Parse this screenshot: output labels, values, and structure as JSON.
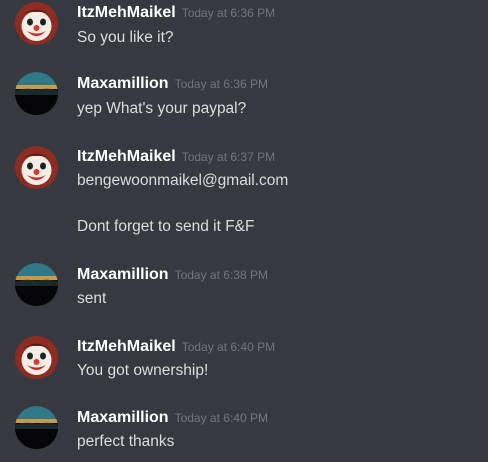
{
  "messages": [
    {
      "author": "ItzMehMaikel",
      "timestamp": "Today at 6:36 PM",
      "avatar": "clown-avatar-icon",
      "lines": [
        "So you like it?"
      ]
    },
    {
      "author": "Maxamillion",
      "timestamp": "Today at 6:36 PM",
      "avatar": "sunset-landscape-avatar-icon",
      "lines": [
        "yep What's your paypal?"
      ]
    },
    {
      "author": "ItzMehMaikel",
      "timestamp": "Today at 6:37 PM",
      "avatar": "clown-avatar-icon",
      "lines": [
        "bengewoonmaikel@gmail.com",
        "Dont forget to send it F&F"
      ]
    },
    {
      "author": "Maxamillion",
      "timestamp": "Today at 6:38 PM",
      "avatar": "sunset-landscape-avatar-icon",
      "lines": [
        "sent"
      ]
    },
    {
      "author": "ItzMehMaikel",
      "timestamp": "Today at 6:40 PM",
      "avatar": "clown-avatar-icon",
      "lines": [
        "You got ownership!"
      ]
    },
    {
      "author": "Maxamillion",
      "timestamp": "Today at 6:40 PM",
      "avatar": "sunset-landscape-avatar-icon",
      "lines": [
        "perfect thanks"
      ]
    }
  ],
  "colors": {
    "background": "#36393f",
    "author": "#ffffff",
    "timestamp": "#72767d",
    "message_text": "#dcddde"
  }
}
